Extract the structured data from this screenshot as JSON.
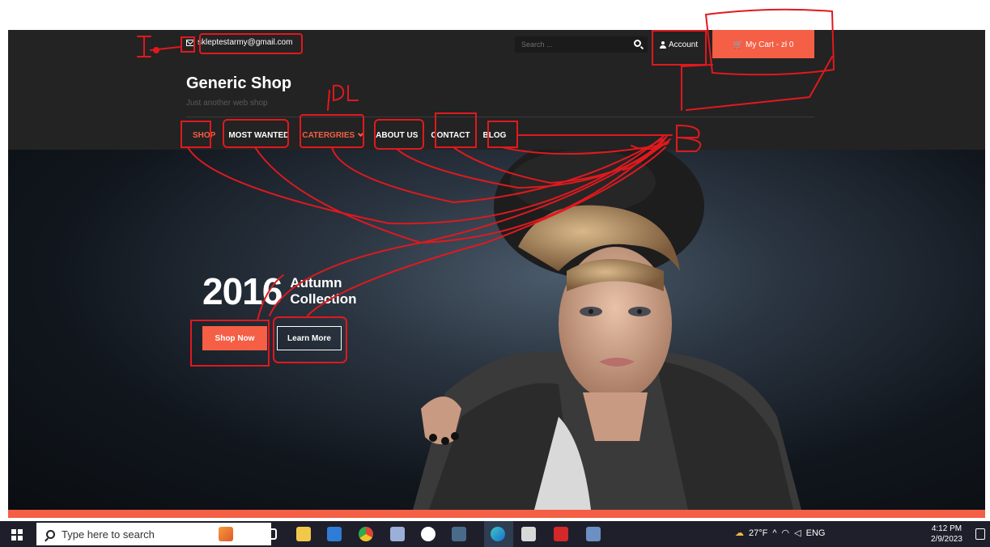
{
  "topbar": {
    "email": "skleptestarmy@gmail.com",
    "search_placeholder": "Search ...",
    "account_label": "Account",
    "cart_label": "My Cart - zł 0"
  },
  "header": {
    "brand": "Generic Shop",
    "tagline": "Just another web shop",
    "nav": [
      {
        "label": "SHOP",
        "active": true
      },
      {
        "label": "MOST WANTED",
        "active": false
      },
      {
        "label": "CATERGRIES",
        "active": true,
        "dropdown": true
      },
      {
        "label": "ABOUT US",
        "active": false
      },
      {
        "label": "CONTACT",
        "active": false
      },
      {
        "label": "BLOG",
        "active": false
      }
    ]
  },
  "hero": {
    "year": "2016",
    "collection_line1": "Autumn",
    "collection_line2": "Collection",
    "shop_now": "Shop Now",
    "learn_more": "Learn More"
  },
  "annotations": {
    "label_i": "I",
    "label_dl": "DL",
    "label_b": "B"
  },
  "taskbar": {
    "search_placeholder": "Type here to search",
    "weather": "27°F",
    "language": "ENG",
    "time": "4:12 PM",
    "date": "2/9/2023"
  },
  "colors": {
    "accent": "#f45f45",
    "dark_bg": "#232323",
    "annotation": "#e0191e"
  }
}
